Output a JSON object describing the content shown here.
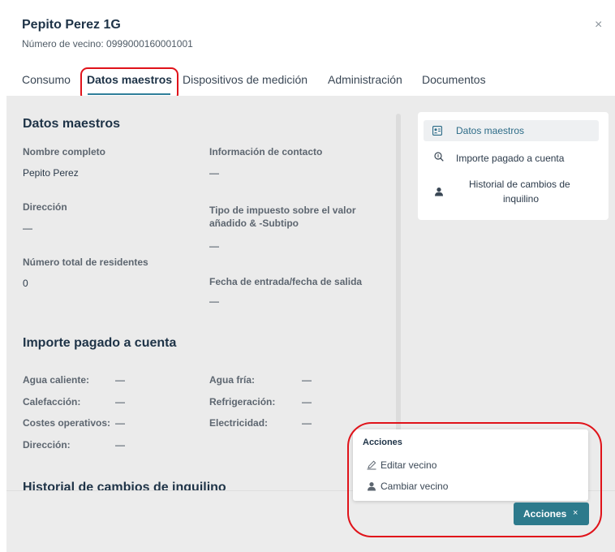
{
  "header": {
    "title": "Pepito Perez 1G",
    "subtitle": "Número de vecino: 0999000160001001",
    "close": "×"
  },
  "tabs": [
    {
      "label": "Consumo",
      "active": false
    },
    {
      "label": "Datos maestros",
      "active": true
    },
    {
      "label": "Dispositivos de medición",
      "active": false
    },
    {
      "label": "Administración",
      "active": false
    },
    {
      "label": "Documentos",
      "active": false
    }
  ],
  "datos_maestros": {
    "title": "Datos maestros",
    "nombre_label": "Nombre completo",
    "nombre_value": "Pepito Perez",
    "contacto_label": "Información de contacto",
    "contacto_value": "—",
    "direccion_label": "Dirección",
    "direccion_value": "—",
    "impuesto_label_1": "Tipo de impuesto sobre el valor",
    "impuesto_label_2": "añadido & -Subtipo",
    "impuesto_value": "—",
    "residentes_label": "Número total de residentes",
    "residentes_value": "0",
    "fecha_label": "Fecha de entrada/fecha de salida",
    "fecha_value": "—"
  },
  "importe": {
    "title": "Importe pagado a cuenta",
    "agua_caliente_label": "Agua caliente:",
    "agua_caliente_value": "—",
    "agua_fria_label": "Agua fría:",
    "agua_fria_value": "—",
    "calefaccion_label": "Calefacción:",
    "calefaccion_value": "—",
    "refrigeracion_label": "Refrigeración:",
    "refrigeracion_value": "—",
    "costes_label": "Costes operativos:",
    "costes_value": "—",
    "electricidad_label": "Electricidad:",
    "electricidad_value": "—",
    "direccion_label": "Dirección:",
    "direccion_value": "—"
  },
  "historial": {
    "title": "Historial de cambios de inquilino"
  },
  "side_nav": {
    "items": [
      {
        "label": "Datos maestros",
        "icon": "id-card-icon"
      },
      {
        "label": "Importe pagado a cuenta",
        "icon": "coin-search-icon"
      },
      {
        "label_1": "Historial de cambios de",
        "label_2": "inquilino",
        "icon": "person-icon"
      }
    ]
  },
  "actions_menu": {
    "title": "Acciones",
    "items": [
      {
        "label": "Editar vecino",
        "icon": "edit-icon"
      },
      {
        "label": "Cambiar vecino",
        "icon": "person-icon"
      }
    ],
    "button_label": "Acciones",
    "button_close": "×"
  },
  "colors": {
    "accent": "#2d7a8c",
    "annotation": "#e0131a",
    "content_bg": "#ebebeb"
  }
}
